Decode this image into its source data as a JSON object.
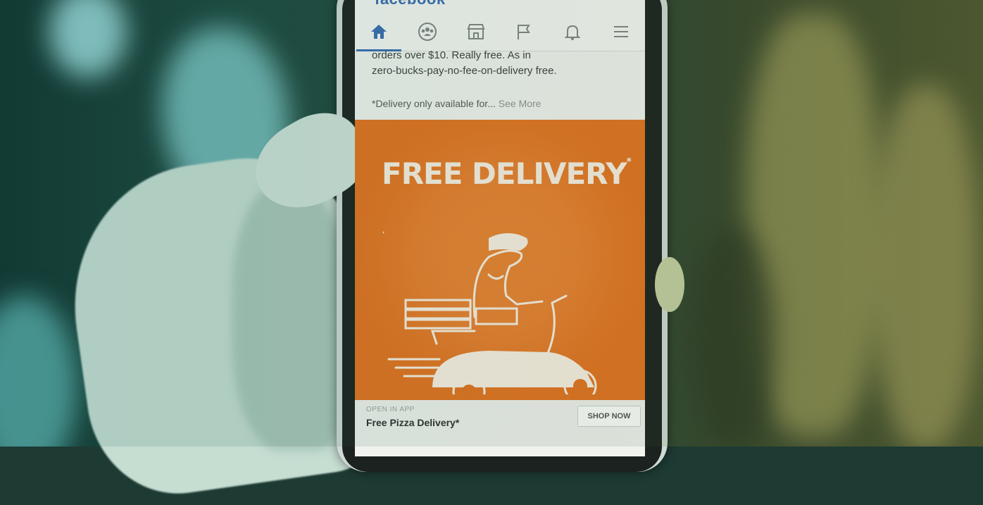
{
  "app": {
    "brand": "facebook",
    "accent": "#3a6fb3"
  },
  "tabs": [
    {
      "icon": "home-icon",
      "active": true
    },
    {
      "icon": "groups-icon",
      "active": false
    },
    {
      "icon": "marketplace-icon",
      "active": false
    },
    {
      "icon": "pages-flag-icon",
      "active": false
    },
    {
      "icon": "notifications-bell-icon",
      "active": false
    },
    {
      "icon": "menu-icon",
      "active": false
    }
  ],
  "post": {
    "line1": "orders over $10. Really free. As in",
    "line2": "zero-bucks-pay-no-fee-on-delivery free.",
    "note": "*Delivery only available for...",
    "see_more": "See More"
  },
  "ad": {
    "headline": "FREE DELIVERY",
    "headline_mark": "*",
    "open_in_app": "OPEN IN APP",
    "title": "Free Pizza Delivery*",
    "cta": "SHOP NOW",
    "color": "#e5731f"
  }
}
